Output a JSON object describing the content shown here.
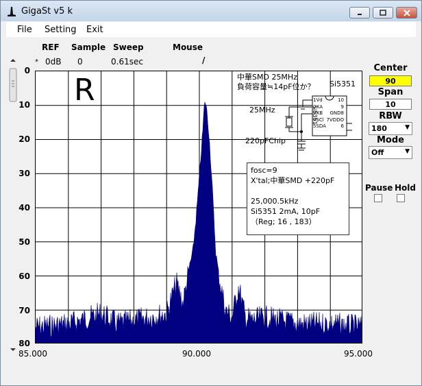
{
  "window": {
    "title": "GigaSt v5 k"
  },
  "menu": [
    "File",
    "Setting",
    "Exit"
  ],
  "status": {
    "headers": {
      "ref": "REF",
      "sample": "Sample",
      "sweep": "Sweep",
      "mouse": "Mouse"
    },
    "values": {
      "star": "*",
      "ref": "0dB",
      "sample": "0",
      "sweep": "0.61sec",
      "mouse": "/"
    }
  },
  "right_panel": {
    "center_label": "Center",
    "center_value": "90",
    "span_label": "Span",
    "span_value": "10",
    "rbw_label": "RBW",
    "rbw_value": "180",
    "mode_label": "Mode",
    "mode_value": "Off",
    "pause_label": "Pause",
    "hold_label": "Hold",
    "colors": {
      "center_bg": "#ffff00"
    }
  },
  "plot": {
    "marker_letter": "R",
    "note_line1": "中華SMD 25MHz",
    "note_line2": "負荷容量≒14pF位か？",
    "chip_name": "Si5351",
    "chip_label_vertical": "Si5351",
    "xtal_label": "25MHz",
    "cap_label": "220pFChip",
    "pins_left": [
      "1Vd",
      "2XA",
      "3XB",
      "4SCl",
      "5SDA"
    ],
    "pins_right": [
      "10",
      "9",
      "GND8",
      "7VDDO",
      "6"
    ],
    "info": {
      "line1": "fosc=9",
      "line2": "X'tal;中華SMD +220pF",
      "line3": "25,000.5kHz",
      "line4": "Si5351 2mA, 10pF",
      "line5": "（Reg;  16 , 183）"
    }
  },
  "chart_data": {
    "type": "area",
    "x_ticks": [
      "85.000",
      "90.000",
      "95.000"
    ],
    "y_ticks": [
      "0",
      "10",
      "20",
      "30",
      "40",
      "50",
      "60",
      "70",
      "80"
    ],
    "xlim": [
      85,
      95
    ],
    "ylim": [
      0,
      80
    ],
    "y_inverted": true,
    "grid": true,
    "color": "#000080",
    "series": [
      {
        "x": [
          85.0,
          86.0,
          87.0,
          87.5,
          88.0,
          88.5,
          89.0,
          89.3,
          89.5,
          89.7,
          89.8,
          89.9,
          90.0,
          90.1,
          90.15,
          90.2,
          90.3,
          90.4,
          90.5,
          90.6,
          90.8,
          91.0,
          91.2,
          91.4,
          91.6,
          92.0,
          93.0,
          94.0,
          95.0
        ],
        "y": [
          75,
          74,
          71,
          74,
          73,
          72,
          71,
          62,
          68,
          57,
          53,
          43,
          31,
          18,
          10,
          9,
          19,
          35,
          53,
          60,
          70,
          72,
          63,
          72,
          73,
          72,
          74,
          74,
          75
        ]
      }
    ]
  }
}
